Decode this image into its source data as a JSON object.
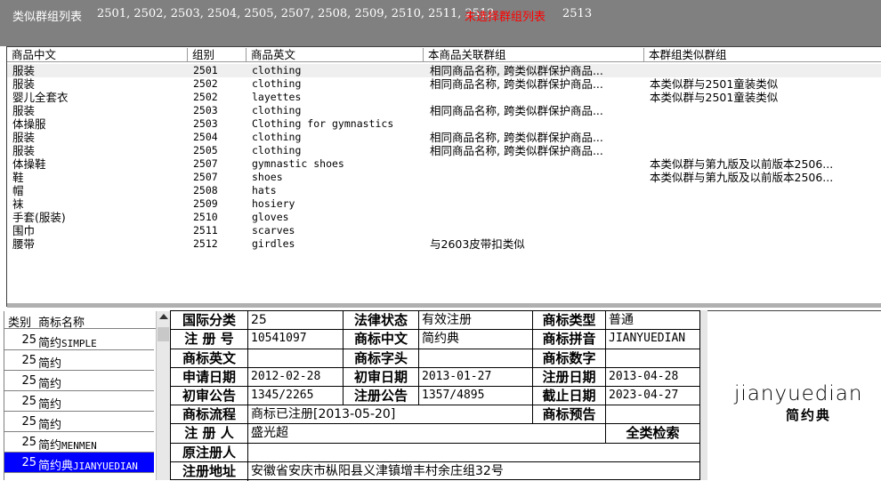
{
  "top_bar": {
    "similar_label": "类似群组列表",
    "similar_codes": "2501, 2502, 2503, 2504, 2505, 2507, 2508, 2509, 2510, 2511, 2512",
    "unselected_label": "未选择群组列表",
    "unselected_codes": "2513"
  },
  "upper_table": {
    "headers": [
      "商品中文",
      "组别",
      "商品英文",
      "本商品关联群组",
      "本群组类似群组"
    ],
    "rows": [
      [
        "服装",
        "2501",
        "clothing",
        "相同商品名称, 跨类似群保护商品...",
        ""
      ],
      [
        "服装",
        "2502",
        "clothing",
        "相同商品名称, 跨类似群保护商品...",
        "本类似群与2501童装类似"
      ],
      [
        "婴儿全套衣",
        "2502",
        "layettes",
        "",
        "本类似群与2501童装类似"
      ],
      [
        "服装",
        "2503",
        "clothing",
        "相同商品名称, 跨类似群保护商品...",
        ""
      ],
      [
        "体操服",
        "2503",
        "Clothing for gymnastics",
        "",
        ""
      ],
      [
        "服装",
        "2504",
        "clothing",
        "相同商品名称, 跨类似群保护商品...",
        ""
      ],
      [
        "服装",
        "2505",
        "clothing",
        "相同商品名称, 跨类似群保护商品...",
        ""
      ],
      [
        "体操鞋",
        "2507",
        "gymnastic shoes",
        "",
        "本类似群与第九版及以前版本2506..."
      ],
      [
        "鞋",
        "2507",
        "shoes",
        "",
        "本类似群与第九版及以前版本2506..."
      ],
      [
        "帽",
        "2508",
        "hats",
        "",
        ""
      ],
      [
        "袜",
        "2509",
        "hosiery",
        "",
        ""
      ],
      [
        "手套(服装)",
        "2510",
        "gloves",
        "",
        ""
      ],
      [
        "围巾",
        "2511",
        "scarves",
        "",
        ""
      ],
      [
        "腰带",
        "2512",
        "girdles",
        "与2603皮带扣类似",
        ""
      ]
    ]
  },
  "left_list": {
    "headers": [
      "类别",
      "商标名称"
    ],
    "rows": [
      {
        "num": "25",
        "name": "简约",
        "name_en": "SIMPLE"
      },
      {
        "num": "25",
        "name": "简约",
        "name_en": ""
      },
      {
        "num": "25",
        "name": "简约",
        "name_en": ""
      },
      {
        "num": "25",
        "name": "简约",
        "name_en": ""
      },
      {
        "num": "25",
        "name": "简约",
        "name_en": ""
      },
      {
        "num": "25",
        "name": "简约",
        "name_en": "MENMEN"
      },
      {
        "num": "25",
        "name": "简约典",
        "name_en": "JIANYUEDIAN"
      }
    ]
  },
  "detail": {
    "intl_class_label": "国际分类",
    "intl_class": "25",
    "legal_status_label": "法律状态",
    "legal_status": "有效注册",
    "mark_type_label": "商标类型",
    "mark_type": "普通",
    "reg_no_label": "注 册 号",
    "reg_no": "10541097",
    "mark_cn_label": "商标中文",
    "mark_cn": "简约典",
    "pinyin_label": "商标拼音",
    "pinyin": "JIANYUEDIAN",
    "mark_en_label": "商标英文",
    "mark_en": "",
    "mark_initial_label": "商标字头",
    "mark_initial": "",
    "mark_digit_label": "商标数字",
    "mark_digit": "",
    "apply_date_label": "申请日期",
    "apply_date": "2012-02-28",
    "prelim_date_label": "初审日期",
    "prelim_date": "2013-01-27",
    "reg_date_label": "注册日期",
    "reg_date": "2013-04-28",
    "prelim_notice_label": "初审公告",
    "prelim_notice": "1345/2265",
    "reg_notice_label": "注册公告",
    "reg_notice": "1357/4895",
    "expire_label": "截止日期",
    "expire": "2023-04-27",
    "flow_label": "商标流程",
    "flow": "商标已注册[2013-05-20]",
    "warning_label": "商标预告",
    "warning": "",
    "registrant_label": "注 册 人",
    "registrant": "盛光超",
    "full_search_label": "全类检索",
    "orig_registrant_label": "原注册人",
    "orig_registrant": "",
    "address_label": "注册地址",
    "address": "安徽省安庆市枞阳县义津镇增丰村余庄组32号"
  },
  "logo": {
    "text_en": "jianyuedian",
    "text_cn": "简约典"
  }
}
